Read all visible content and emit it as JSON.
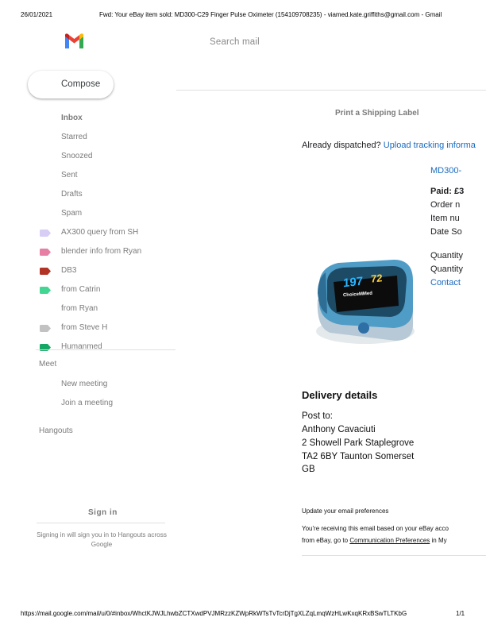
{
  "print_header": {
    "date": "26/01/2021",
    "title": "Fwd: Your eBay item sold: MD300-C29 Finger Pulse Oximeter (154109708235) - viamed.kate.griffiths@gmail.com - Gmail"
  },
  "search": {
    "placeholder": "Search mail"
  },
  "compose": {
    "label": "Compose"
  },
  "nav": {
    "items": [
      {
        "label": "Inbox"
      },
      {
        "label": "Starred"
      },
      {
        "label": "Snoozed"
      },
      {
        "label": "Sent"
      },
      {
        "label": "Drafts"
      },
      {
        "label": "Spam"
      }
    ],
    "labels": [
      {
        "label": "AX300 query from SH",
        "color": "#d7cdf5"
      },
      {
        "label": "blender info from Ryan",
        "color": "#e77fa5"
      },
      {
        "label": "DB3",
        "color": "#b33226"
      },
      {
        "label": "from Catrin",
        "color": "#42d692"
      },
      {
        "label": "from Ryan",
        "color": ""
      },
      {
        "label": "from Steve H",
        "color": "#c2c2c2"
      },
      {
        "label": "Humanmed",
        "color": "#16a765"
      }
    ]
  },
  "meet": {
    "title": "Meet",
    "new_meeting": "New meeting",
    "join_meeting": "Join a meeting"
  },
  "hangouts": {
    "title": "Hangouts",
    "sign_in": "Sign in",
    "hint": "Signing in will sign you in to Hangouts across Google"
  },
  "email": {
    "print_label": "Print a Shipping Label",
    "dispatched_text": "Already dispatched?",
    "upload_link": "Upload tracking informa",
    "item_link": "MD300-",
    "paid": "Paid: £3",
    "order_number": "Order n",
    "item_number": "Item nu",
    "date_sold": "Date So",
    "quantity1": "Quantity",
    "quantity2": "Quantity",
    "contact_link": "Contact",
    "delivery_title": "Delivery details",
    "post_to": "Post to:",
    "name": "Anthony Cavaciuti",
    "street": "2 Showell Park Staplegrove",
    "city": "TA2 6BY Taunton Somerset",
    "country": "GB",
    "prefs": "Update your email preferences",
    "receiving": "You're receiving this email based on your eBay acco",
    "from_ebay": "from eBay, go to",
    "comm_prefs": "Communication Preferences",
    "in_my": "in My"
  },
  "device": {
    "display_left": "197",
    "display_right": "72",
    "brand": "ChoiceMMed"
  },
  "footer": {
    "url": "https://mail.google.com/mail/u/0/#inbox/WhctKJWJLhwbZCTXwdPVJMRzzKZWpRkWTsTvTcrDjTgXLZqLmqWzHLwKxqKRxBSwTLTKbG",
    "page": "1/1"
  }
}
